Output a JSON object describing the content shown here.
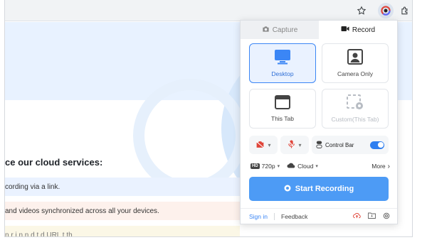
{
  "browser": {
    "icons": [
      "star-icon",
      "extension-active-icon",
      "puzzle-icon",
      "more-icon"
    ]
  },
  "page": {
    "heading": "ce our cloud services:",
    "rows": [
      "cording via a link.",
      "and videos synchronized across all your devices.",
      "n   r    i    n       n   d   t    d URL t   th"
    ]
  },
  "popup": {
    "tabs": {
      "capture": "Capture",
      "record": "Record"
    },
    "modes": {
      "desktop": "Desktop",
      "camera_only": "Camera Only",
      "this_tab": "This Tab",
      "custom": "Custom(This Tab)"
    },
    "controls": {
      "control_bar": "Control Bar",
      "control_bar_on": true
    },
    "options": {
      "quality": "720p",
      "storage": "Cloud",
      "more": "More"
    },
    "start_label": "Start Recording",
    "footer": {
      "sign_in": "Sign in",
      "feedback": "Feedback"
    },
    "colors": {
      "accent": "#3b86f5",
      "button": "#4d9bf5",
      "mic_off": "#e0453a"
    }
  }
}
